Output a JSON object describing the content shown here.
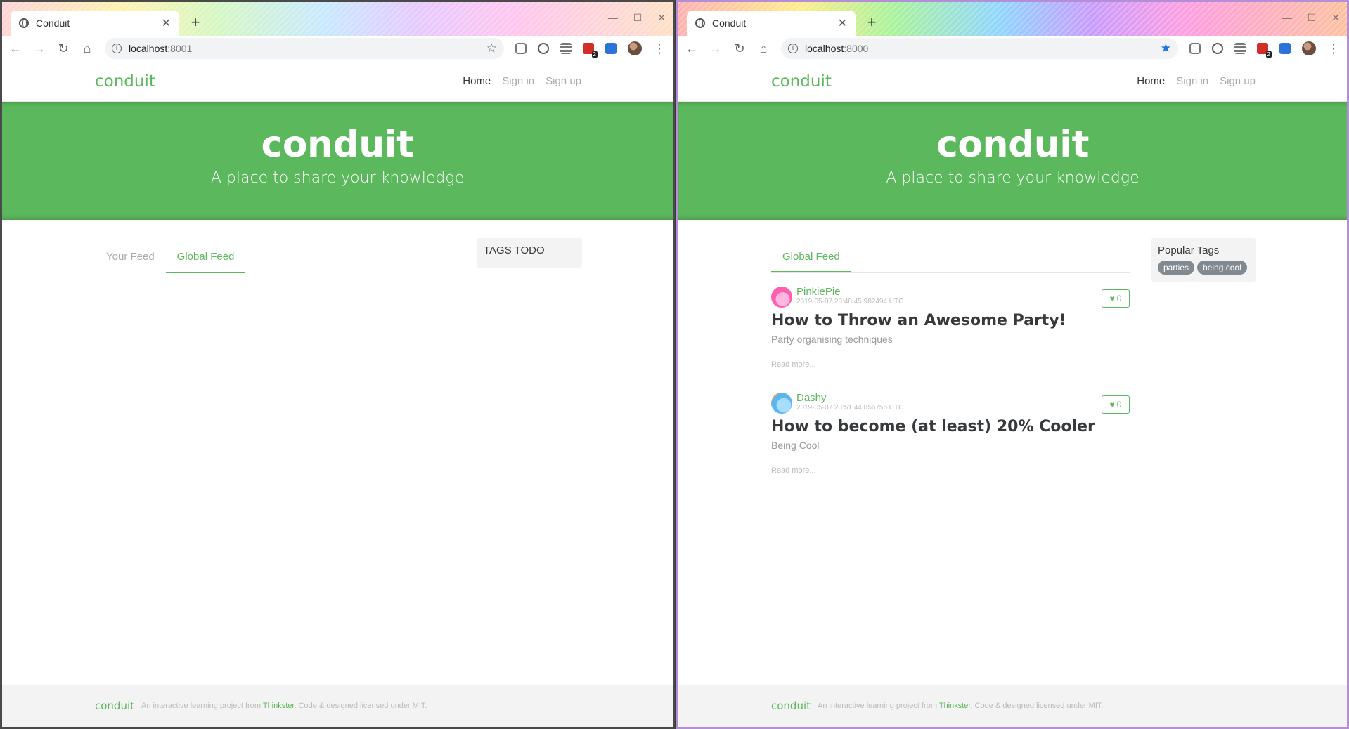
{
  "left": {
    "tab_title": "Conduit",
    "url_host": "localhost",
    "url_port": ":8001",
    "brand": "conduit",
    "nav": {
      "home": "Home",
      "sign_in": "Sign in",
      "sign_up": "Sign up"
    },
    "banner": {
      "title": "conduit",
      "subtitle": "A place to share your knowledge"
    },
    "feed_tabs": {
      "your_feed": "Your Feed",
      "global_feed": "Global Feed"
    },
    "sidebar_text": "TAGS TODO",
    "footer": {
      "logo": "conduit",
      "text_pre": "An interactive learning project from ",
      "link": "Thinkster",
      "text_post": ". Code & designed licensed under MIT."
    }
  },
  "right": {
    "tab_title": "Conduit",
    "url_host": "localhost",
    "url_port": ":8000",
    "bookmarked": true,
    "brand": "conduit",
    "nav": {
      "home": "Home",
      "sign_in": "Sign in",
      "sign_up": "Sign up"
    },
    "banner": {
      "title": "conduit",
      "subtitle": "A place to share your knowledge"
    },
    "feed_tabs": {
      "global_feed": "Global Feed"
    },
    "sidebar": {
      "title": "Popular Tags",
      "tags": [
        "parties",
        "being cool"
      ]
    },
    "articles": [
      {
        "author": "PinkiePie",
        "date": "2019-05-07 23:48:45.982494 UTC",
        "likes": "0",
        "title": "How to Throw an Awesome Party!",
        "description": "Party organising techniques",
        "read_more": "Read more..."
      },
      {
        "author": "Dashy",
        "date": "2019-05-07 23:51:44.856755 UTC",
        "likes": "0",
        "title": "How to become (at least) 20% Cooler",
        "description": "Being Cool",
        "read_more": "Read more..."
      }
    ],
    "footer": {
      "logo": "conduit",
      "text_pre": "An interactive learning project from ",
      "link": "Thinkster",
      "text_post": ". Code & designed licensed under MIT."
    }
  },
  "toolbar": {
    "back_icon": "back-arrow-icon",
    "forward_icon": "forward-arrow-icon",
    "reload_icon": "reload-icon",
    "home_icon": "home-icon",
    "ext_badge": "2"
  },
  "colors": {
    "brand_green": "#5cb85c",
    "tag_grey": "#818a91"
  }
}
